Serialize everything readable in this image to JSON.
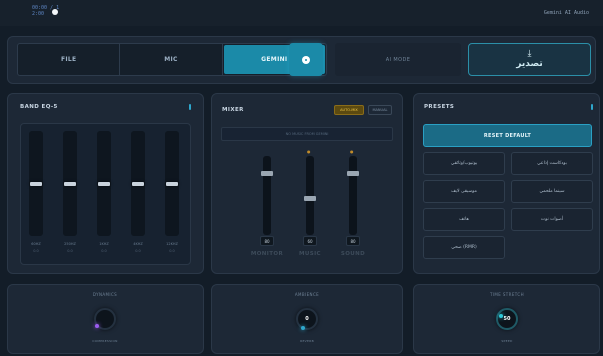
{
  "status": {
    "line1": "00:00 / 1",
    "line2": "2:00"
  },
  "brand": "Gemini AI Audio",
  "tabs": [
    {
      "label": "FILE"
    },
    {
      "label": "MIC"
    },
    {
      "label": "GEMINI"
    }
  ],
  "ai_mode_label": "AI MODE",
  "export_label": "تصدير",
  "eq": {
    "title": "BAND EQ-5",
    "bands": [
      {
        "label": "60HZ",
        "value": "0.0",
        "level": 0.5
      },
      {
        "label": "250HZ",
        "value": "0.0",
        "level": 0.5
      },
      {
        "label": "1KHZ",
        "value": "0.0",
        "level": 0.5
      },
      {
        "label": "4KHZ",
        "value": "0.0",
        "level": 0.5
      },
      {
        "label": "12KHZ",
        "value": "0.0",
        "level": 0.5
      }
    ]
  },
  "mixer": {
    "title": "MIXER",
    "auto_label": "AUTO-MIX",
    "manual_label": "MANUAL",
    "display_text": "NO MUSIC FROM GEMINI",
    "channels": [
      {
        "name": "MONITOR",
        "value": "80",
        "level": 0.8
      },
      {
        "name": "MUSIC",
        "value": "60",
        "level": 0.45
      },
      {
        "name": "SOUND",
        "value": "80",
        "level": 0.8
      }
    ]
  },
  "presets": {
    "title": "PRESETS",
    "reset_label": "RESET DEFAULT",
    "items": [
      "بودكاست إذاعي",
      "يوتيوب/وثائقي",
      "سينما ملحمي",
      "موسيقى لايف",
      "أصوات نوت",
      "هاتف",
      "صحي (RMR)"
    ]
  },
  "knobs": [
    {
      "title": "DYNAMICS",
      "value": "",
      "sub": "COMPRESSION",
      "color": "#9b5cf0"
    },
    {
      "title": "AMBIENCE",
      "value": "0",
      "sub": "REVERB",
      "color": "#2ea7cc"
    },
    {
      "title": "TIME STRETCH",
      "value": "50",
      "sub": "SPEED",
      "color": "#2ec7d6"
    }
  ]
}
